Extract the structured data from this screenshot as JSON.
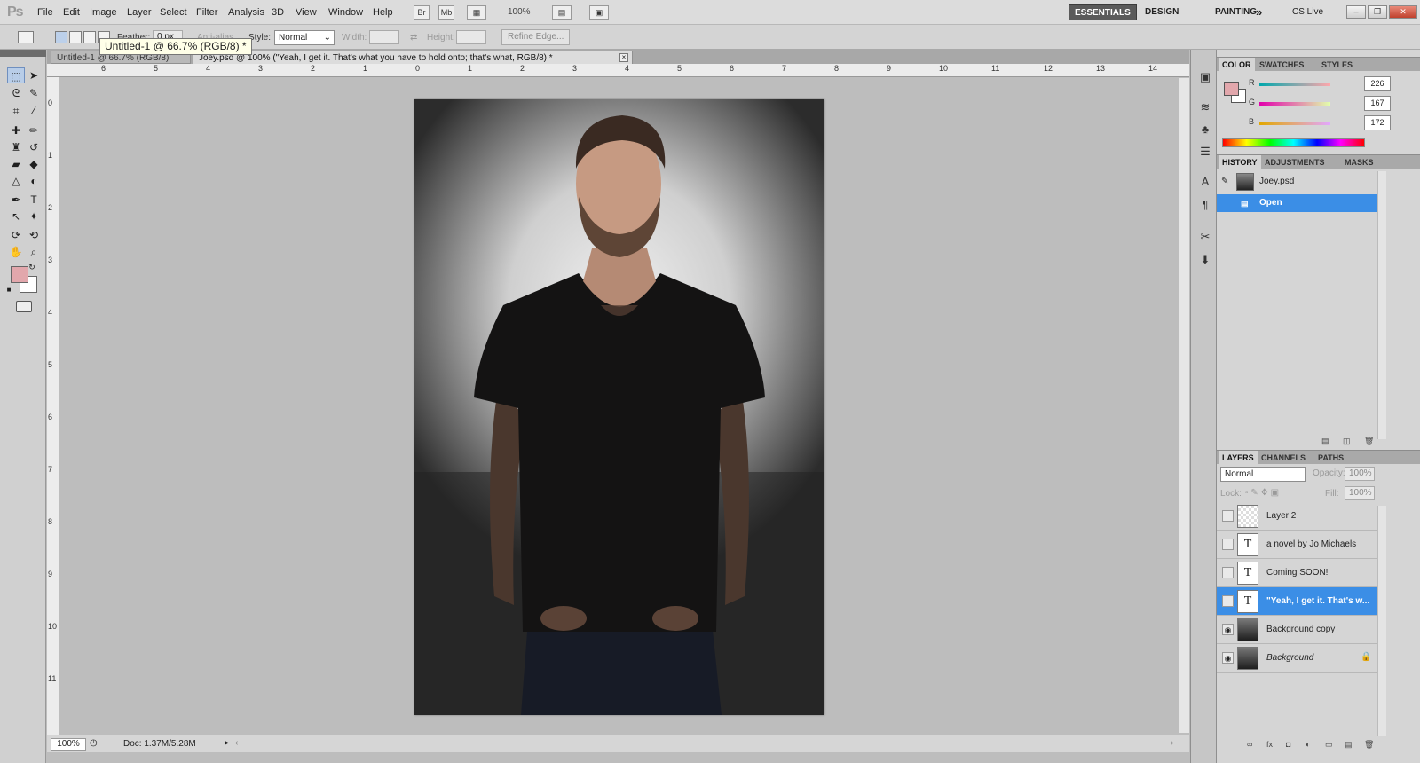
{
  "app": {
    "logo": "Ps"
  },
  "menu": [
    "File",
    "Edit",
    "Image",
    "Layer",
    "Select",
    "Filter",
    "Analysis",
    "3D",
    "View",
    "Window",
    "Help"
  ],
  "appbar": {
    "bridge": "Br",
    "minibridge": "Mb",
    "zoom": "100%"
  },
  "workspaces": {
    "essentials": "ESSENTIALS",
    "design": "DESIGN",
    "painting": "PAINTING",
    "more": "»",
    "cslive": "CS Live"
  },
  "options": {
    "feather_label": "Feather:",
    "feather_value": "0 px",
    "antialias_label": "Anti-alias",
    "style_label": "Style:",
    "style_value": "Normal",
    "width_label": "Width:",
    "height_label": "Height:",
    "refine_edge": "Refine Edge..."
  },
  "tooltip": "Untitled-1 @ 66.7% (RGB/8) *",
  "tabs": [
    {
      "label": "Untitled-1 @ 66.7% (RGB/8)"
    },
    {
      "label": "Joey.psd @ 100% (\"Yeah, I get it. That's what you have to hold onto; that's what, RGB/8) *"
    }
  ],
  "ruler": {
    "top": [
      "6",
      "5",
      "4",
      "3",
      "2",
      "1",
      "0",
      "1",
      "2",
      "3",
      "4",
      "5",
      "6",
      "7",
      "8",
      "9",
      "10",
      "11",
      "12",
      "13",
      "14"
    ],
    "left": [
      "0",
      "1",
      "2",
      "3",
      "4",
      "5",
      "6",
      "7",
      "8",
      "9",
      "10",
      "11"
    ]
  },
  "status": {
    "zoom": "100%",
    "doc": "Doc: 1.37M/5.28M"
  },
  "color_panel": {
    "tabs": [
      "COLOR",
      "SWATCHES",
      "STYLES"
    ],
    "channels": [
      {
        "label": "R",
        "value": "226"
      },
      {
        "label": "G",
        "value": "167"
      },
      {
        "label": "B",
        "value": "172"
      }
    ],
    "foreground": "#e2a7ac"
  },
  "history_panel": {
    "tabs": [
      "HISTORY",
      "ADJUSTMENTS",
      "MASKS"
    ],
    "snapshot": "Joey.psd",
    "steps": [
      "Open"
    ]
  },
  "layers_panel": {
    "tabs": [
      "LAYERS",
      "CHANNELS",
      "PATHS"
    ],
    "blend_mode": "Normal",
    "opacity_label": "Opacity:",
    "opacity": "100%",
    "lock_label": "Lock:",
    "fill_label": "Fill:",
    "fill": "100%",
    "layers": [
      {
        "name": "Layer 2",
        "kind": "raster-empty",
        "visible": false
      },
      {
        "name": "a novel by Jo Michaels",
        "kind": "text",
        "visible": false
      },
      {
        "name": "Coming SOON!",
        "kind": "text",
        "visible": false
      },
      {
        "name": "\"Yeah, I get it. That's w...",
        "kind": "text",
        "visible": false
      },
      {
        "name": "Background copy",
        "kind": "photo",
        "visible": true
      },
      {
        "name": "Background",
        "kind": "photo",
        "visible": true
      }
    ]
  },
  "icons": {
    "eye": "eye-icon",
    "lock": "lock-icon",
    "text_layer": "T"
  }
}
